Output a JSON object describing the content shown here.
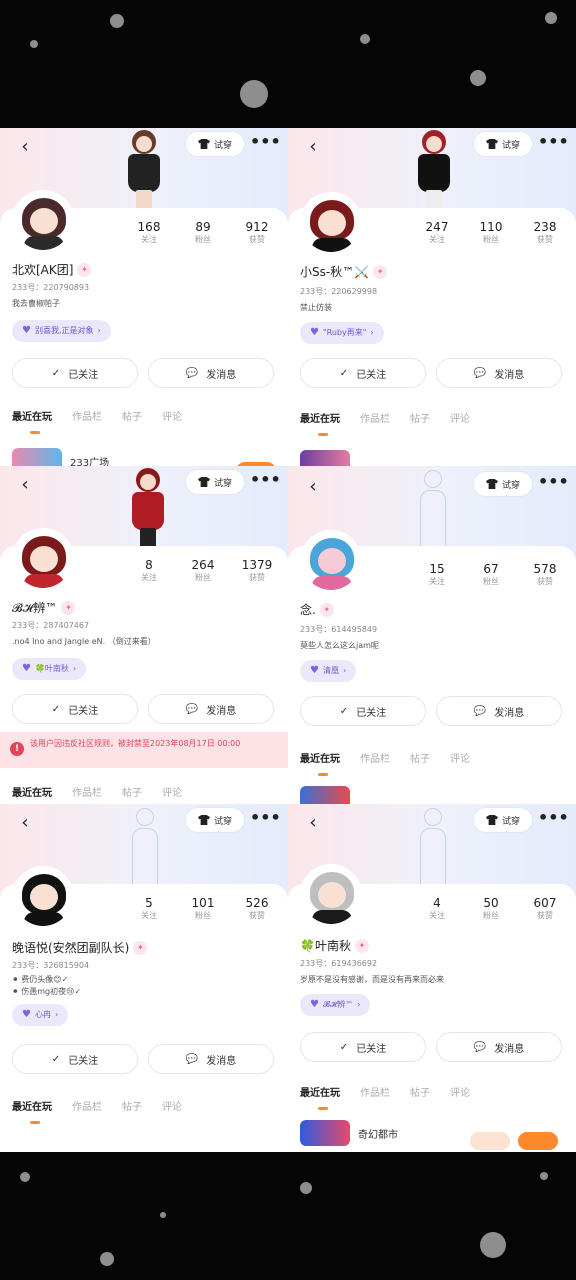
{
  "colors": {
    "accent": "#ff8a2b",
    "cp_bg": "#ece8fb",
    "cp_text": "#6c5bd6",
    "warn_bg": "#fde3e6",
    "warn_text": "#e0455a"
  },
  "icons": {
    "back": "chevron-left-icon",
    "tryon": "shirt-icon",
    "more": "more-icon",
    "follow": "check-icon",
    "message": "chat-icon",
    "warning": "warning-icon"
  },
  "common": {
    "tryon_label": "试穿",
    "more_label": "•••",
    "back_label": "‹",
    "follow_label": "已关注",
    "message_label": "发消息",
    "label_following": "关注",
    "label_fans": "粉丝",
    "label_likes": "获赞",
    "tabs": [
      "最近在玩",
      "作品栏",
      "帖子",
      "评论"
    ]
  },
  "profiles": [
    {
      "name": "北欢[AK团]",
      "id_line": "233号：220790893",
      "signature": "我去曹椒帕子",
      "stats": {
        "following": "168",
        "fans": "89",
        "likes": "912"
      },
      "cp_label": "别喜我,正是对象"
    },
    {
      "name": "小Ss-秋™⚔️",
      "id_line": "233号：220629998",
      "signature": "禁止仿装",
      "stats": {
        "following": "247",
        "fans": "110",
        "likes": "238"
      },
      "cp_label": "\"Ruby再来\""
    },
    {
      "name": "𝓑𝓗辨™",
      "id_line": "233号：287407467",
      "signature": ".no4 Ino and Jangle eN. （倒过来看）",
      "stats": {
        "following": "8",
        "fans": "264",
        "likes": "1379"
      },
      "cp_label": "🍀叶南秋"
    },
    {
      "name": "念.",
      "id_line": "233号：614495849",
      "signature": "莫些人怎么这么jam呢",
      "stats": {
        "following": "15",
        "fans": "67",
        "likes": "578"
      },
      "cp_label": "清凰"
    },
    {
      "name": "晚语悦(安然团副队长)",
      "id_line": "233号：326815904",
      "signature": "⚫ 费仍头像😊✓",
      "signature2": "⚫ 伤愚mg初夜😢✓",
      "stats": {
        "following": "5",
        "fans": "101",
        "likes": "526"
      },
      "cp_label": "心冉"
    },
    {
      "name": "🍀叶南秋",
      "id_line": "233号：619436692",
      "signature": "岁原不是没有感谢，而是没有再来而必来",
      "stats": {
        "following": "4",
        "fans": "50",
        "likes": "607"
      },
      "cp_label": "𝓑𝓗辨™"
    }
  ],
  "feeds": {
    "p1": "233广场",
    "p6": "奇幻都市"
  },
  "warning": {
    "text": "该用户因违反社区规则，被封禁至2023年08月17日 00:00"
  }
}
